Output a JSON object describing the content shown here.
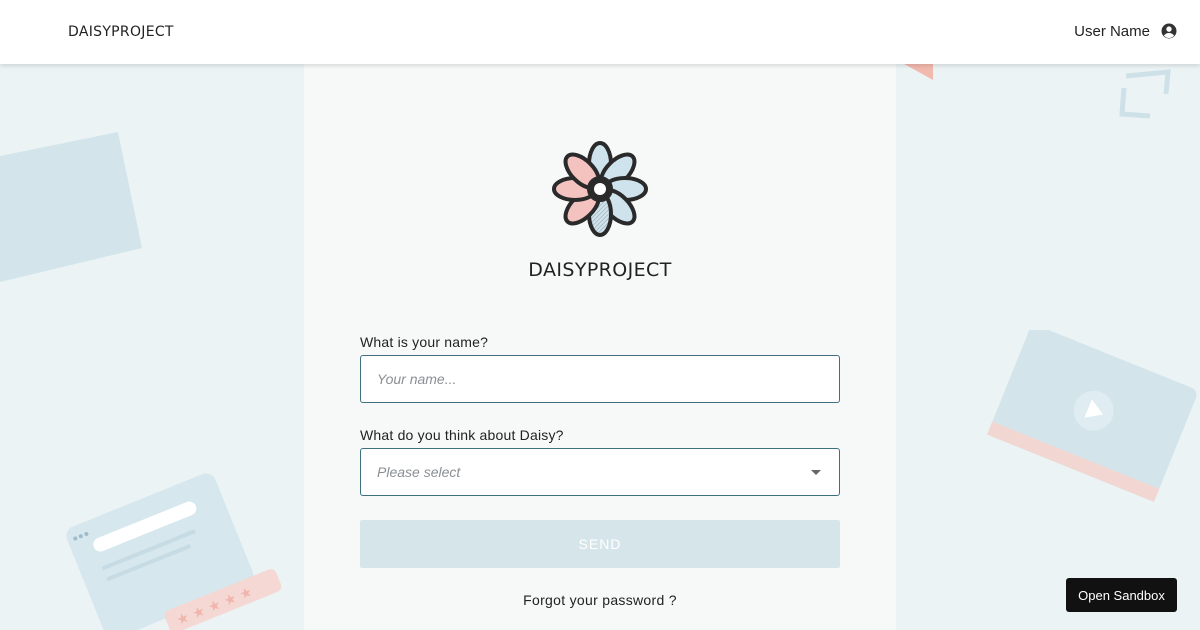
{
  "header": {
    "brand": "DAISYPROJECT",
    "user_name": "User Name",
    "user_icon": "account-circle-icon"
  },
  "panel": {
    "logo_icon": "daisy-flower-icon",
    "logo_text": "DAISYPROJECT",
    "name_field": {
      "label": "What is your name?",
      "placeholder": "Your name..."
    },
    "opinion_field": {
      "label": "What do you think about Daisy?",
      "placeholder": "Please select"
    },
    "send_label": "SEND",
    "forgot_label": "Forgot your password ?"
  },
  "sandbox_label": "Open Sandbox",
  "colors": {
    "input_border": "#3f6f80",
    "send_disabled": "#d6e5ea",
    "background": "#ebf3f5",
    "petal_pink": "#f4c3c0",
    "petal_blue": "#cfe3ec"
  }
}
